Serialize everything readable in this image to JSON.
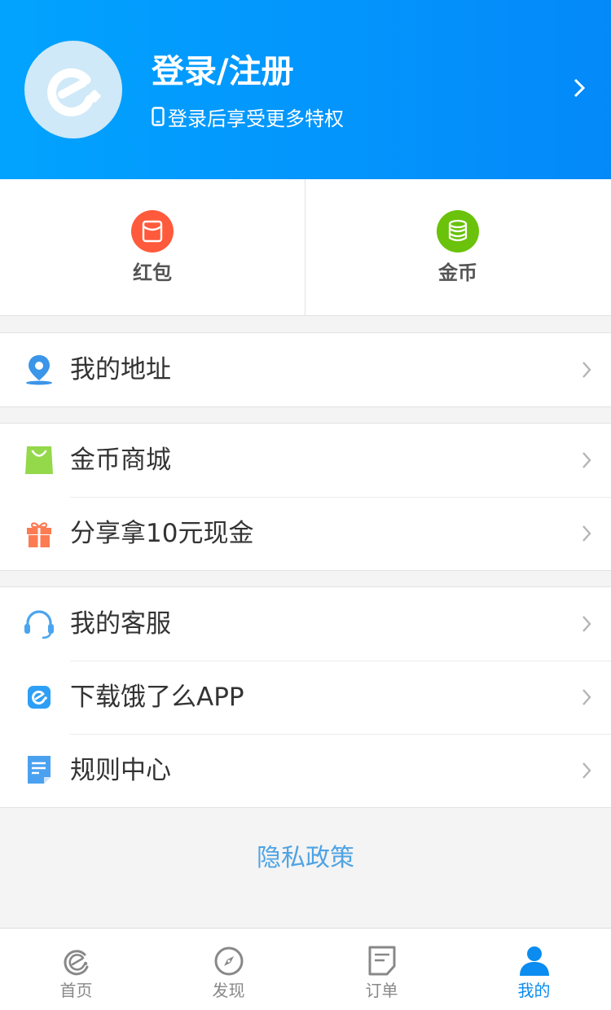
{
  "header": {
    "title": "登录/注册",
    "subtitle": "登录后享受更多特权",
    "avatar_icon": "eleme-logo-icon",
    "phone_icon": "phone-icon",
    "arrow_icon": "chevron-right-icon"
  },
  "assets": [
    {
      "label": "红包",
      "icon": "red-packet-icon",
      "color": "#ff5a3b"
    },
    {
      "label": "金币",
      "icon": "coin-stack-icon",
      "color": "#6ac20b"
    }
  ],
  "groups": [
    {
      "items": [
        {
          "label": "我的地址",
          "icon": "location-pin-icon",
          "color": "#3b95e9"
        }
      ]
    },
    {
      "items": [
        {
          "label": "金币商城",
          "icon": "shopping-bag-icon",
          "color": "#94d94a"
        },
        {
          "label": "分享拿10元现金",
          "icon": "gift-icon",
          "color": "#fc7b53"
        }
      ]
    },
    {
      "items": [
        {
          "label": "我的客服",
          "icon": "headset-icon",
          "color": "#4aa5f0"
        },
        {
          "label": "下载饿了么APP",
          "icon": "eleme-app-icon",
          "color": "#2e9ff6"
        },
        {
          "label": "规则中心",
          "icon": "document-icon",
          "color": "#4aa1ef"
        }
      ]
    }
  ],
  "privacy": {
    "label": "隐私政策"
  },
  "tabs": [
    {
      "label": "首页",
      "icon": "home-eleme-icon",
      "active": false
    },
    {
      "label": "发现",
      "icon": "compass-icon",
      "active": false
    },
    {
      "label": "订单",
      "icon": "order-list-icon",
      "active": false
    },
    {
      "label": "我的",
      "icon": "user-profile-icon",
      "active": true
    }
  ],
  "colors": {
    "header_start": "#02a3ff",
    "header_end": "#0489f9",
    "active_tab": "#0a8cf0",
    "inactive_tab": "#888888",
    "privacy_link": "#4fa3e4"
  }
}
